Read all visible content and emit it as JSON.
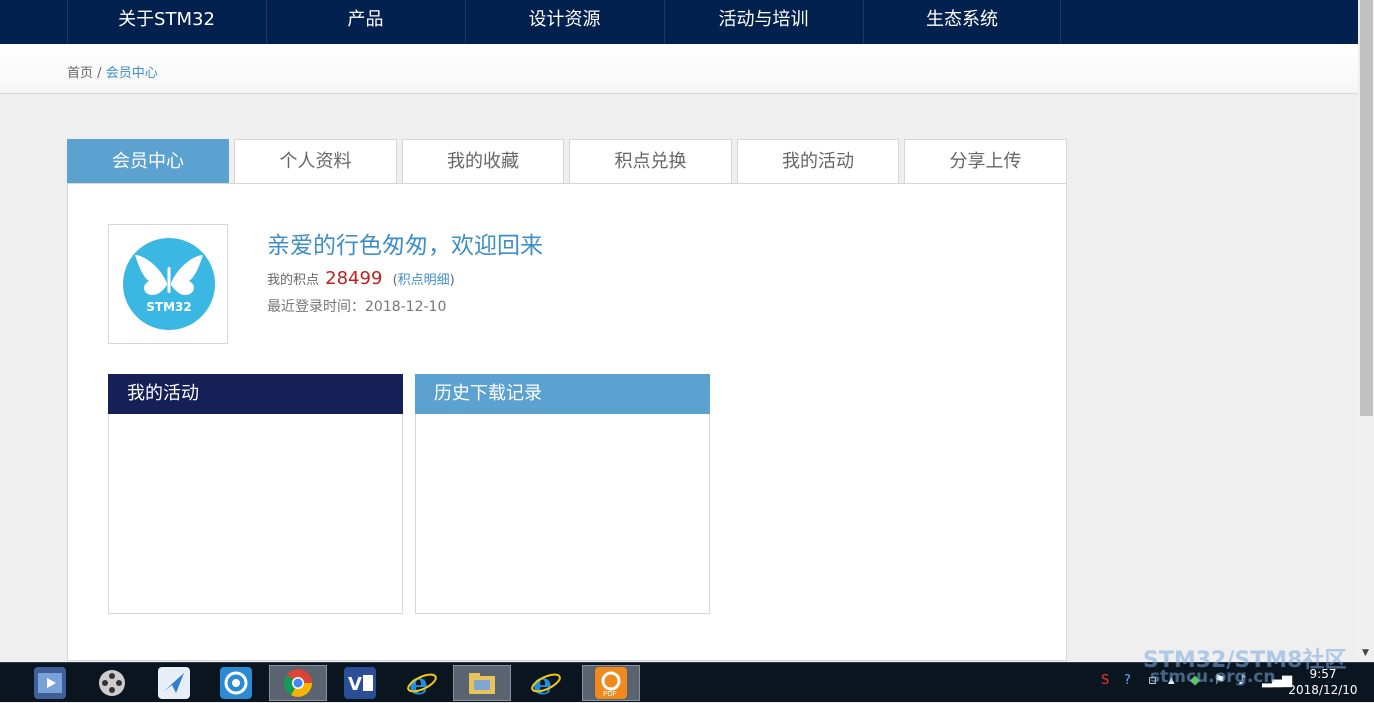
{
  "nav": {
    "items": [
      {
        "label": "关于STM32"
      },
      {
        "label": "产品"
      },
      {
        "label": "设计资源"
      },
      {
        "label": "活动与培训"
      },
      {
        "label": "生态系统"
      }
    ]
  },
  "breadcrumb": {
    "home": "首页",
    "separator": "/",
    "current": "会员中心"
  },
  "tabs": [
    {
      "label": "会员中心",
      "active": true
    },
    {
      "label": "个人资料"
    },
    {
      "label": "我的收藏"
    },
    {
      "label": "积点兑换"
    },
    {
      "label": "我的活动"
    },
    {
      "label": "分享上传"
    }
  ],
  "profile": {
    "logo_text": "STM32",
    "welcome": "亲爱的行色匆匆，欢迎回来",
    "points_label": "我的积点",
    "points_value": "28499",
    "points_link": "积点明细",
    "last_login": "最近登录时间：2018-12-10"
  },
  "boxes": {
    "activity_title": "我的活动",
    "downloads_title": "历史下载记录"
  },
  "taskbar": {
    "time": "9:57",
    "date": "2018/12/10",
    "watermark_line1": "STM32/STM8社区",
    "watermark_line2": "stmcu.org.cn"
  },
  "colors": {
    "nav_bg": "#03214f",
    "tab_active": "#5ba2d0",
    "link_blue": "#3e8fc7",
    "points_red": "#c0211d",
    "activity_header": "#142056",
    "downloads_header": "#5ba2d0"
  }
}
